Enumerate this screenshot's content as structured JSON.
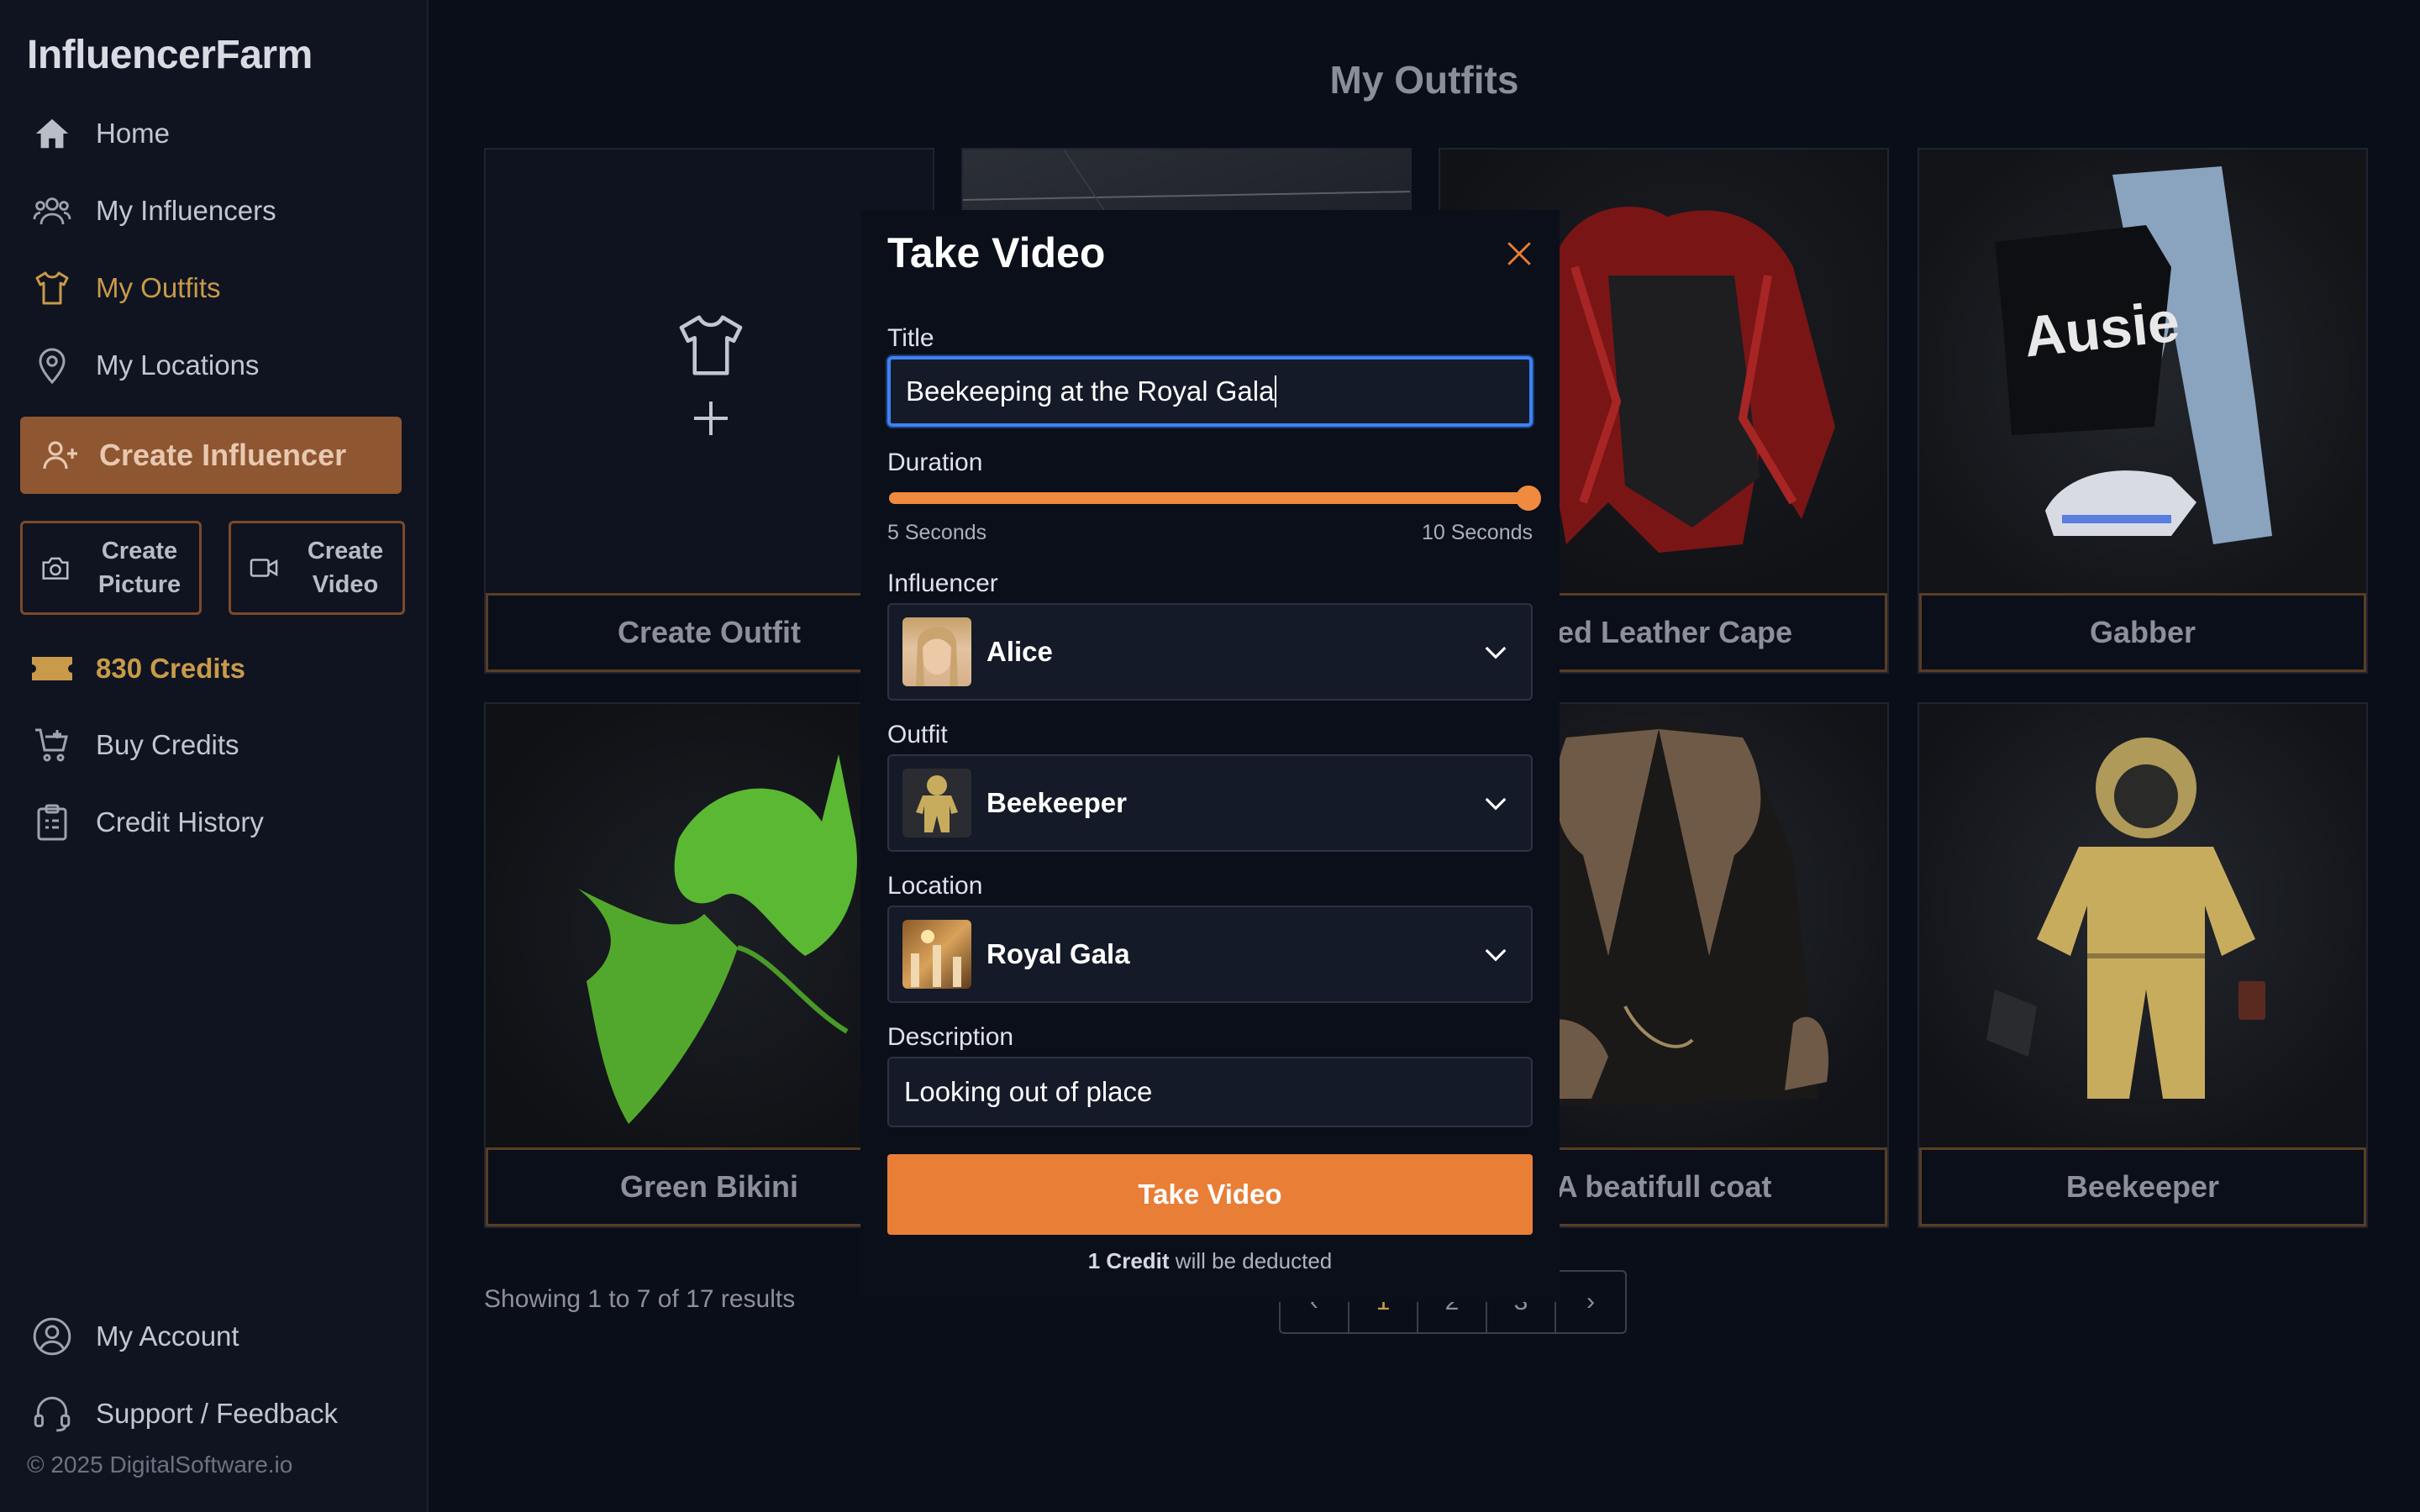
{
  "app": {
    "brand": "InfluencerFarm",
    "copyright": "© 2025 DigitalSoftware.io"
  },
  "sidebar": {
    "nav": [
      {
        "label": "Home",
        "icon": "home-icon"
      },
      {
        "label": "My Influencers",
        "icon": "users-icon"
      },
      {
        "label": "My Outfits",
        "icon": "shirt-icon",
        "active": true
      },
      {
        "label": "My Locations",
        "icon": "map-pin-icon"
      }
    ],
    "create_influencer": "Create Influencer",
    "create_picture": [
      "Create",
      "Picture"
    ],
    "create_video": [
      "Create",
      "Video"
    ],
    "credits": "830 Credits",
    "buy_credits": "Buy Credits",
    "credit_history": "Credit History",
    "my_account": "My Account",
    "support": "Support / Feedback"
  },
  "main": {
    "title": "My Outfits",
    "cards": [
      {
        "caption": "Create Outfit"
      },
      {
        "caption": ""
      },
      {
        "caption": "Red Leather Cape"
      },
      {
        "caption": "Gabber"
      },
      {
        "caption": "Green Bikini"
      },
      {
        "caption": ""
      },
      {
        "caption": "A beatifull coat"
      },
      {
        "caption": "Beekeeper"
      }
    ],
    "showing": "Showing 1 to 7 of 17 results",
    "pagination": [
      "‹",
      "1",
      "2",
      "3",
      "›"
    ]
  },
  "modal": {
    "title": "Take Video",
    "title_label": "Title",
    "title_value": "Beekeeping at the Royal Gala",
    "duration_label": "Duration",
    "duration_min": "5 Seconds",
    "duration_max": "10 Seconds",
    "duration_value": 10,
    "influencer_label": "Influencer",
    "influencer_value": "Alice",
    "outfit_label": "Outfit",
    "outfit_value": "Beekeeper",
    "location_label": "Location",
    "location_value": "Royal Gala",
    "description_label": "Description",
    "description_value": "Looking out of place",
    "submit": "Take Video",
    "deduct_strong": "1 Credit",
    "deduct_rest": " will be deducted"
  },
  "colors": {
    "accent": "#e97e37",
    "gold": "#c99a4a",
    "focus": "#3b82f6"
  }
}
